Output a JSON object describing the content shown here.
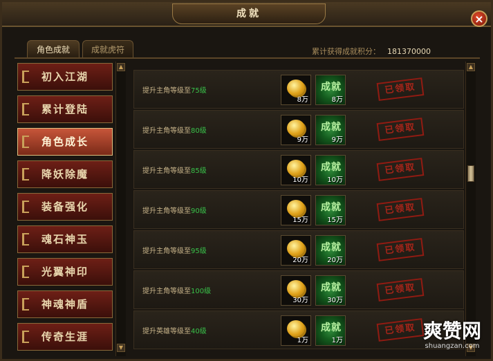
{
  "window": {
    "title": "成就",
    "close_label": "×"
  },
  "tabs": [
    {
      "label": "角色成就",
      "active": true
    },
    {
      "label": "成就虎符",
      "active": false
    }
  ],
  "score": {
    "label": "累计获得成就积分：",
    "value": "181370000"
  },
  "sidebar": {
    "items": [
      {
        "label": "初入江湖",
        "active": false
      },
      {
        "label": "累计登陆",
        "active": false
      },
      {
        "label": "角色成长",
        "active": true
      },
      {
        "label": "降妖除魔",
        "active": false
      },
      {
        "label": "装备强化",
        "active": false
      },
      {
        "label": "魂石神玉",
        "active": false
      },
      {
        "label": "光翼神印",
        "active": false
      },
      {
        "label": "神魂神盾",
        "active": false
      },
      {
        "label": "传奇生涯",
        "active": false
      }
    ]
  },
  "achievements": [
    {
      "desc": "提升主角等级至",
      "level": "75级",
      "coin_qty": "8万",
      "ach_label": "成就",
      "ach_qty": "8万",
      "status": "已领取"
    },
    {
      "desc": "提升主角等级至",
      "level": "80级",
      "coin_qty": "9万",
      "ach_label": "成就",
      "ach_qty": "9万",
      "status": "已领取"
    },
    {
      "desc": "提升主角等级至",
      "level": "85级",
      "coin_qty": "10万",
      "ach_label": "成就",
      "ach_qty": "10万",
      "status": "已领取"
    },
    {
      "desc": "提升主角等级至",
      "level": "90级",
      "coin_qty": "15万",
      "ach_label": "成就",
      "ach_qty": "15万",
      "status": "已领取"
    },
    {
      "desc": "提升主角等级至",
      "level": "95级",
      "coin_qty": "20万",
      "ach_label": "成就",
      "ach_qty": "20万",
      "status": "已领取"
    },
    {
      "desc": "提升主角等级至",
      "level": "100级",
      "coin_qty": "30万",
      "ach_label": "成就",
      "ach_qty": "30万",
      "status": "已领取"
    },
    {
      "desc": "提升英雄等级至",
      "level": "40级",
      "coin_qty": "1万",
      "ach_label": "成就",
      "ach_qty": "1万",
      "status": "已领取"
    }
  ],
  "watermark": {
    "brand": "爽赞网",
    "url": "shuangzan.com"
  },
  "colors": {
    "accent_gold": "#c9a15a",
    "level_green": "#39c24a",
    "stamp_red": "#b5261a",
    "active_tab": "#c7563a"
  }
}
